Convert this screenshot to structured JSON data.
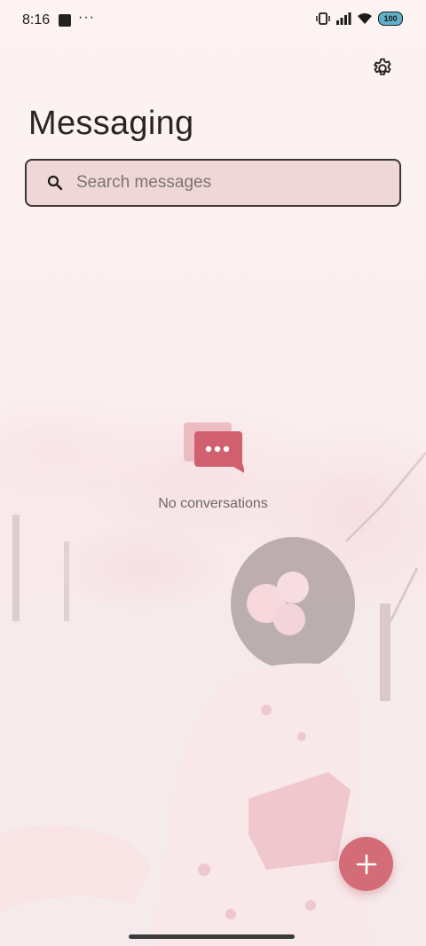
{
  "status_bar": {
    "time": "8:16",
    "overflow": "···",
    "battery_label": "100",
    "icons": [
      "vibrate-icon",
      "signal-icon",
      "wifi-icon",
      "battery-icon"
    ]
  },
  "header": {
    "title": "Messaging",
    "settings_icon": "gear-icon"
  },
  "search": {
    "placeholder": "Search messages",
    "value": ""
  },
  "empty_state": {
    "icon": "chat-bubbles-icon",
    "text": "No conversations"
  },
  "fab": {
    "icon": "plus-icon"
  },
  "colors": {
    "accent": "#d46c78",
    "background": "#fdf3f3",
    "search_fill": "#eed7d6",
    "text_primary": "#2a2525"
  }
}
